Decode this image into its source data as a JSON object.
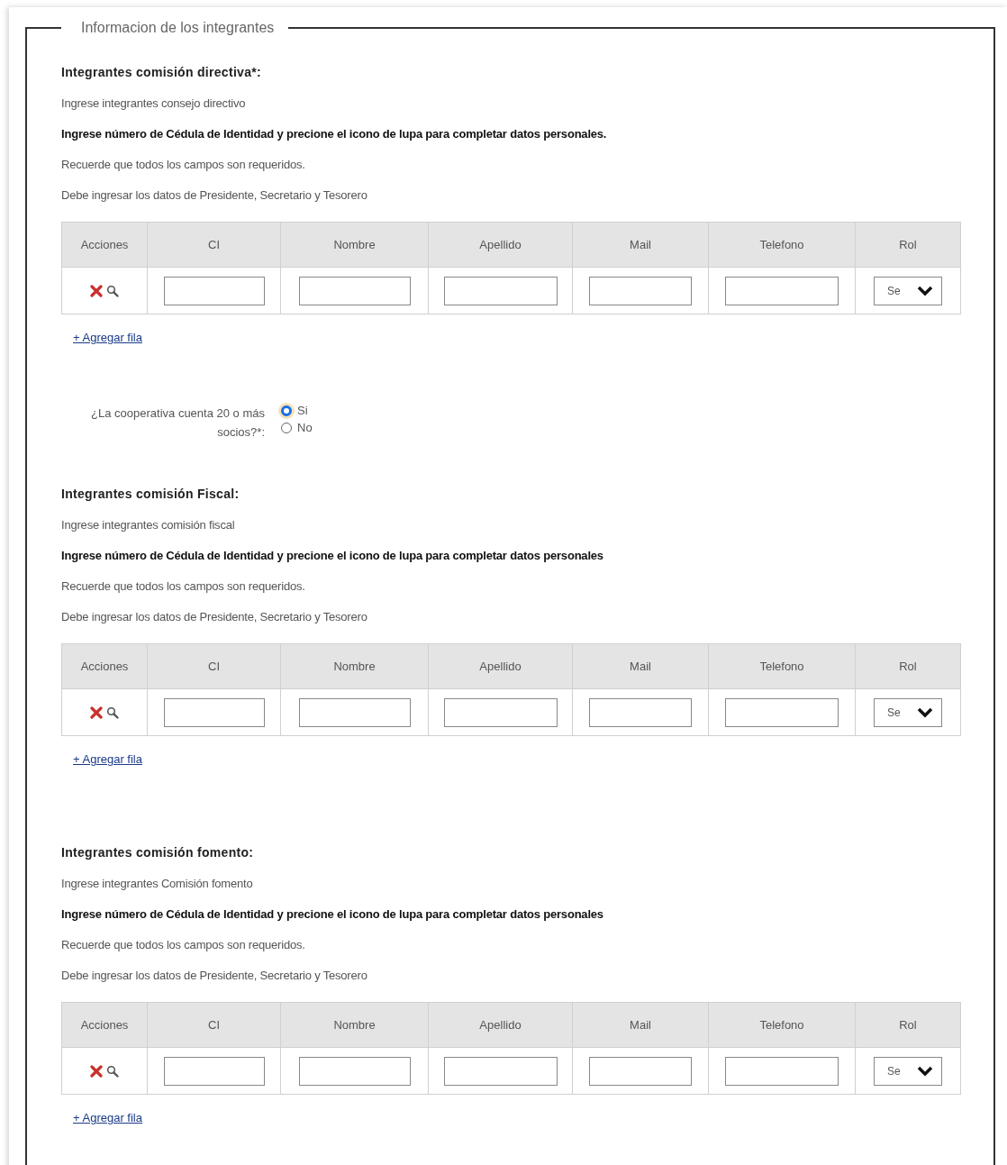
{
  "legend": "Informacion de los integrantes",
  "blocks": [
    {
      "kind": "section",
      "title": "Integrantes comisión directiva*:",
      "lines": [
        {
          "text": "Ingrese integrantes consejo directivo",
          "bold": false
        },
        {
          "text": "Ingrese número de Cédula de Identidad y precione el icono de lupa para completar datos personales.",
          "bold": true
        },
        {
          "text": "Recuerde que todos los campos son requeridos.",
          "bold": false
        },
        {
          "text": "Debe ingresar los datos de Presidente, Secretario y Tesorero",
          "bold": false
        }
      ],
      "table": {
        "columns": [
          "Acciones",
          "CI",
          "Nombre",
          "Apellido",
          "Mail",
          "Telefono",
          "Rol"
        ],
        "rows": [
          {
            "rol": "Se"
          }
        ]
      },
      "add_link": "+ Agregar fila"
    },
    {
      "kind": "question",
      "label": "¿La cooperativa cuenta 20 o más socios?*:",
      "options": [
        {
          "label": "Si",
          "selected": true
        },
        {
          "label": "No",
          "selected": false
        }
      ]
    },
    {
      "kind": "section",
      "title": "Integrantes comisión Fiscal:",
      "lines": [
        {
          "text": "Ingrese integrantes comisión fiscal",
          "bold": false
        },
        {
          "text": "Ingrese número de Cédula de Identidad y precione el icono de lupa para completar datos personales",
          "bold": true
        },
        {
          "text": "Recuerde que todos los campos son requeridos.",
          "bold": false
        },
        {
          "text": "Debe ingresar los datos de Presidente, Secretario y Tesorero",
          "bold": false
        }
      ],
      "table": {
        "columns": [
          "Acciones",
          "CI",
          "Nombre",
          "Apellido",
          "Mail",
          "Telefono",
          "Rol"
        ],
        "rows": [
          {
            "rol": "Se"
          }
        ]
      },
      "add_link": "+ Agregar fila"
    },
    {
      "kind": "section",
      "title": "Integrantes comisión fomento:",
      "lines": [
        {
          "text": "Ingrese integrantes Comisión fomento",
          "bold": false
        },
        {
          "text": "Ingrese número de Cédula de Identidad y precione el icono de lupa para completar datos personales",
          "bold": true
        },
        {
          "text": "Recuerde que todos los campos son requeridos.",
          "bold": false
        },
        {
          "text": "Debe ingresar los datos de Presidente, Secretario y Tesorero",
          "bold": false
        }
      ],
      "table": {
        "columns": [
          "Acciones",
          "CI",
          "Nombre",
          "Apellido",
          "Mail",
          "Telefono",
          "Rol"
        ],
        "rows": [
          {
            "rol": "Se"
          }
        ]
      },
      "add_link": "+ Agregar fila"
    }
  ]
}
